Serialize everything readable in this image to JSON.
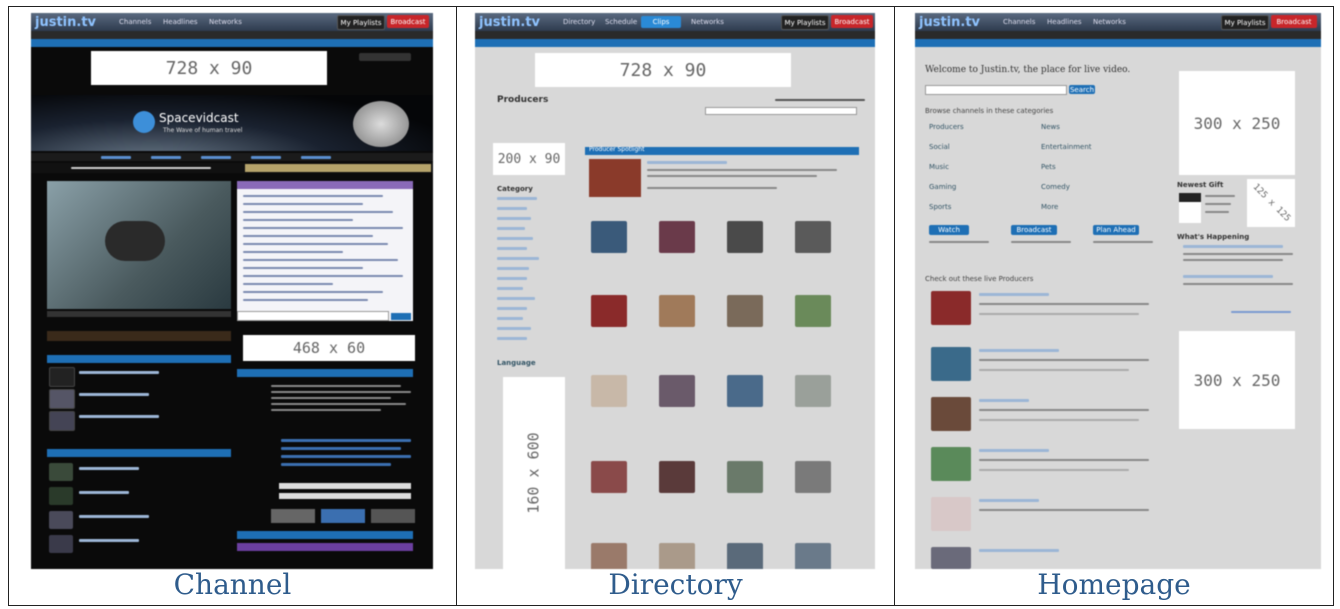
{
  "captions": {
    "channel": "Channel",
    "directory": "Directory",
    "homepage": "Homepage"
  },
  "ads": {
    "channel_leaderboard": "728 x 90",
    "channel_banner": "468 x 60",
    "directory_leaderboard": "728 x 90",
    "directory_button": "200 x 90",
    "directory_skyscraper": "160 x 600",
    "home_rect_top": "300 x 250",
    "home_square": "125 x 125",
    "home_rect_bottom": "300 x 250"
  },
  "site": {
    "logo": "justin.tv",
    "nav": [
      "Channels",
      "Headlines",
      "Networks"
    ],
    "directory_nav": [
      "Directory",
      "Schedule",
      "Clips",
      "Networks"
    ],
    "my_playlists": "My Playlists",
    "broadcast": "Broadcast"
  },
  "channel": {
    "name": "Spacevidcast",
    "tagline": "The Wave of human travel"
  },
  "directory": {
    "heading": "Producers",
    "spotlight": "Producer Spotlight",
    "category": "Category",
    "language": "Language"
  },
  "homepage": {
    "welcome": "Welcome to Justin.tv, the place for live video.",
    "search_button": "Search",
    "browse": "Browse channels in these categories",
    "categories": [
      "Producers",
      "News",
      "Social",
      "Entertainment",
      "Music",
      "Pets",
      "Gaming",
      "Comedy",
      "Sports",
      "More"
    ],
    "cta": [
      "Watch",
      "Broadcast",
      "Plan Ahead"
    ],
    "check_out": "Check out these live Producers",
    "newest": "Newest Gift",
    "happening": "What's Happening"
  },
  "colors": {
    "jtv_blue": "#1e6fb5",
    "dark_bg": "#0a0a0a",
    "caption": "#2f5c8c",
    "broadcast_red": "#c8262a",
    "purple": "#6b3fa0"
  }
}
